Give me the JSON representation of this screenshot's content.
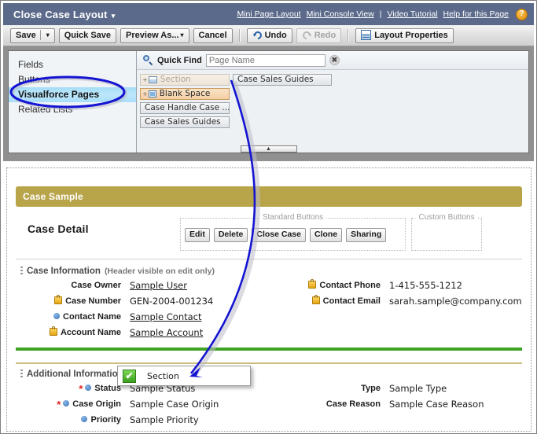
{
  "header": {
    "title": "Close Case Layout",
    "caret": "▾",
    "links": [
      {
        "label": "Mini Page Layout"
      },
      {
        "label": "Mini Console View"
      },
      {
        "label": "Video Tutorial"
      },
      {
        "label": "Help for this Page"
      }
    ],
    "separator": "|",
    "help_icon": "?",
    "bg_color": "#5b6a8a"
  },
  "toolbar": {
    "save_label": "Save",
    "save_caret": "▾",
    "quick_save_label": "Quick Save",
    "preview_as_label": "Preview As...",
    "preview_caret": "▾",
    "cancel_label": "Cancel",
    "undo_label": "Undo",
    "redo_label": "Redo",
    "layout_properties_label": "Layout Properties"
  },
  "palette": {
    "categories": [
      {
        "label": "Fields",
        "selected": false
      },
      {
        "label": "Buttons",
        "selected": false
      },
      {
        "label": "Visualforce Pages",
        "selected": true
      },
      {
        "label": "Related Lists",
        "selected": false
      }
    ],
    "quick_find": {
      "label": "Quick Find",
      "placeholder": "Page Name",
      "value": "",
      "clear_icon": "✖"
    },
    "items_col1": [
      {
        "label": "Section",
        "state": "ghost",
        "icon": "section-icon",
        "plus": "+"
      },
      {
        "label": "Blank Space",
        "state": "active",
        "icon": "blank-space-icon",
        "plus": "+"
      },
      {
        "label": "Case Handle Case ...",
        "state": "normal",
        "icon": "",
        "plus": ""
      },
      {
        "label": "Case Sales Guides",
        "state": "normal",
        "icon": "",
        "plus": ""
      }
    ],
    "items_col2": [
      {
        "label": "Case Sales Guides",
        "state": "normal",
        "icon": "",
        "plus": ""
      }
    ],
    "collapse_handle": "▲"
  },
  "preview": {
    "banner_title": "Case Sample",
    "banner_color": "#b8a449",
    "detail_title": "Case Detail",
    "standard_buttons_group_label": "Standard Buttons",
    "custom_buttons_group_label": "Custom Buttons",
    "standard_buttons": [
      "Edit",
      "Delete",
      "Close Case",
      "Clone",
      "Sharing"
    ],
    "custom_buttons": [],
    "case_information": {
      "header": "Case Information",
      "header_note": "(Header visible on edit only)",
      "left_fields": [
        {
          "label": "Case Owner",
          "value": "Sample User",
          "icon": "",
          "required": false,
          "link": true
        },
        {
          "label": "Case Number",
          "value": "GEN-2004-001234",
          "icon": "lock-icon",
          "required": false,
          "link": false
        },
        {
          "label": "Contact Name",
          "value": "Sample Contact",
          "icon": "dot-icon",
          "required": false,
          "link": true
        },
        {
          "label": "Account Name",
          "value": "Sample Account",
          "icon": "lock-icon",
          "required": false,
          "link": true
        }
      ],
      "right_fields": [
        {
          "label": "Contact Phone",
          "value": "1-415-555-1212",
          "icon": "lock-icon",
          "required": false,
          "link": false
        },
        {
          "label": "Contact Email",
          "value": "sarah.sample@company.com",
          "icon": "lock-icon",
          "required": false,
          "link": false
        }
      ]
    },
    "additional_information": {
      "header": "Additional Information",
      "left_fields": [
        {
          "label": "Status",
          "value": "Sample Status",
          "icon": "dot-icon",
          "required": true,
          "link": false
        },
        {
          "label": "Case Origin",
          "value": "Sample Case Origin",
          "icon": "dot-icon",
          "required": true,
          "link": false
        },
        {
          "label": "Priority",
          "value": "Sample Priority",
          "icon": "dot-icon",
          "required": false,
          "link": false
        }
      ],
      "right_fields": [
        {
          "label": "Type",
          "value": "Sample Type",
          "icon": "",
          "required": false,
          "link": false
        },
        {
          "label": "Case Reason",
          "value": "Sample Case Reason",
          "icon": "",
          "required": false,
          "link": false
        }
      ]
    },
    "divider_green_color": "#3fa424",
    "divider_gold_color": "#cbbd7e"
  },
  "drop_tooltip": {
    "label": "Section",
    "check_icon": "✔"
  },
  "annotations": {
    "highlight_color": "#1414d2",
    "ellipse_target": "Visualforce Pages",
    "arrow_from": "palette Section item",
    "arrow_to": "Section drop tooltip"
  }
}
